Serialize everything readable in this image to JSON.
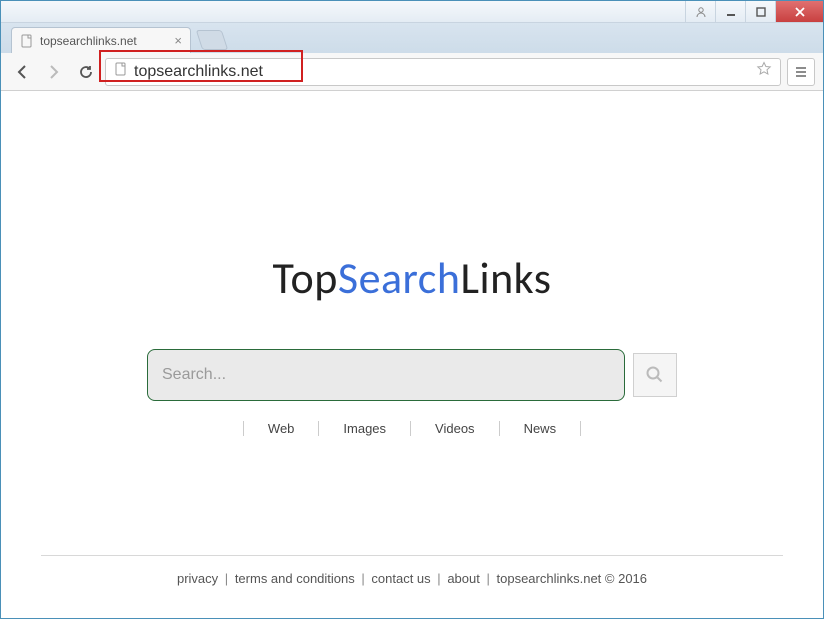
{
  "browser": {
    "tab_title": "topsearchlinks.net",
    "url": "topsearchlinks.net"
  },
  "page": {
    "logo": {
      "part1": "Top",
      "part2": "Search",
      "part3": "Links"
    },
    "search_placeholder": "Search...",
    "tabs": {
      "web": "Web",
      "images": "Images",
      "videos": "Videos",
      "news": "News"
    },
    "footer": {
      "privacy": "privacy",
      "terms": "terms and conditions",
      "contact": "contact us",
      "about": "about",
      "copyright": "topsearchlinks.net © 2016"
    }
  }
}
